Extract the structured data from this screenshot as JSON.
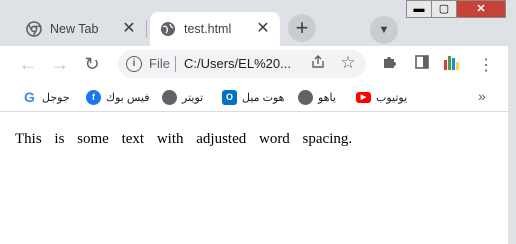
{
  "tabs": [
    {
      "label": "New Tab",
      "icon": "chrome-icon",
      "active": false
    },
    {
      "label": "test.html",
      "icon": "globe-icon",
      "active": true
    }
  ],
  "tab_close_symbol": "✕",
  "new_tab_symbol": "+",
  "window_controls": {
    "minimize": "▬",
    "maximize": "▢",
    "close": "✕"
  },
  "toolbar": {
    "back": "←",
    "forward": "→",
    "reload": "↻"
  },
  "omnibox": {
    "scheme_label": "File",
    "url": "C:/Users/EL%20..."
  },
  "bookmarks": [
    {
      "label": "جوجل",
      "icon": "google-icon",
      "color": "#4285f4"
    },
    {
      "label": "فيس بوك",
      "icon": "facebook-icon",
      "color": "#1877f2"
    },
    {
      "label": "تويتر",
      "icon": "globe-icon",
      "color": "#5f6368"
    },
    {
      "label": "هوت ميل",
      "icon": "outlook-icon",
      "color": "#0072c6"
    },
    {
      "label": "ياهو",
      "icon": "globe-icon",
      "color": "#5f6368"
    },
    {
      "label": "يوتيوب",
      "icon": "youtube-icon",
      "color": "#ff0000"
    }
  ],
  "bookmarks_overflow": "»",
  "page": {
    "text": "This is some text with adjusted word spacing."
  }
}
